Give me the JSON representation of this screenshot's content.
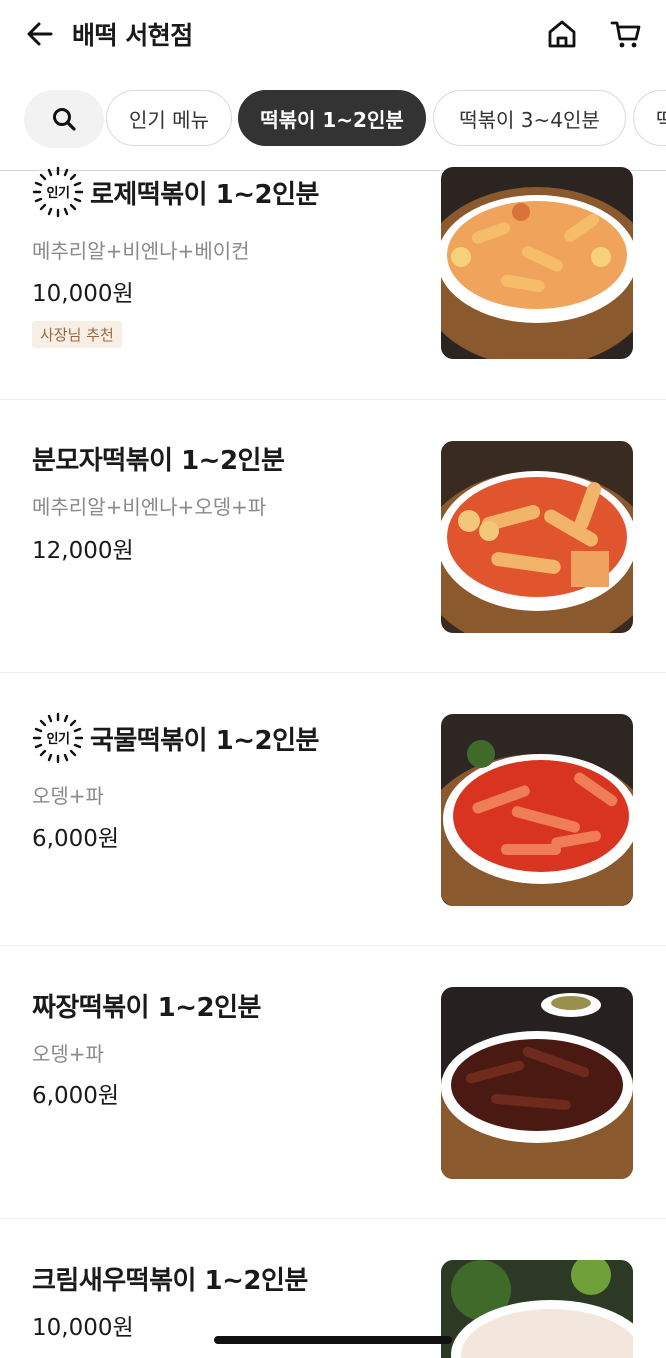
{
  "header": {
    "title": "배떡 서현점"
  },
  "icons": {
    "back": "back-arrow-icon",
    "home": "home-icon",
    "cart": "cart-icon",
    "search": "search-icon"
  },
  "tabs": [
    {
      "label": "인기 메뉴",
      "active": false
    },
    {
      "label": "떡볶이 1~2인분",
      "active": true
    },
    {
      "label": "떡볶이 3~4인분",
      "active": false
    },
    {
      "label": "떡",
      "active": false
    }
  ],
  "popular_label": "인기",
  "menu": [
    {
      "name": "로제떡볶이 1~2인분",
      "desc": "메추리알+비엔나+베이컨",
      "price": "10,000원",
      "badge": "사장님 추천",
      "popular": true,
      "sauce": "#f0a35a"
    },
    {
      "name": "분모자떡볶이 1~2인분",
      "desc": "메추리알+비엔나+오뎅+파",
      "price": "12,000원",
      "popular": false,
      "sauce": "#e0552e"
    },
    {
      "name": "국물떡볶이 1~2인분",
      "desc": "오뎅+파",
      "price": "6,000원",
      "popular": true,
      "sauce": "#d9341f"
    },
    {
      "name": "짜장떡볶이 1~2인분",
      "desc": "오뎅+파",
      "price": "6,000원",
      "popular": false,
      "sauce": "#4a1a12"
    },
    {
      "name": "크림새우떡볶이 1~2인분",
      "price": "10,000원",
      "popular": false,
      "sauce": "#f3e6dc"
    }
  ]
}
